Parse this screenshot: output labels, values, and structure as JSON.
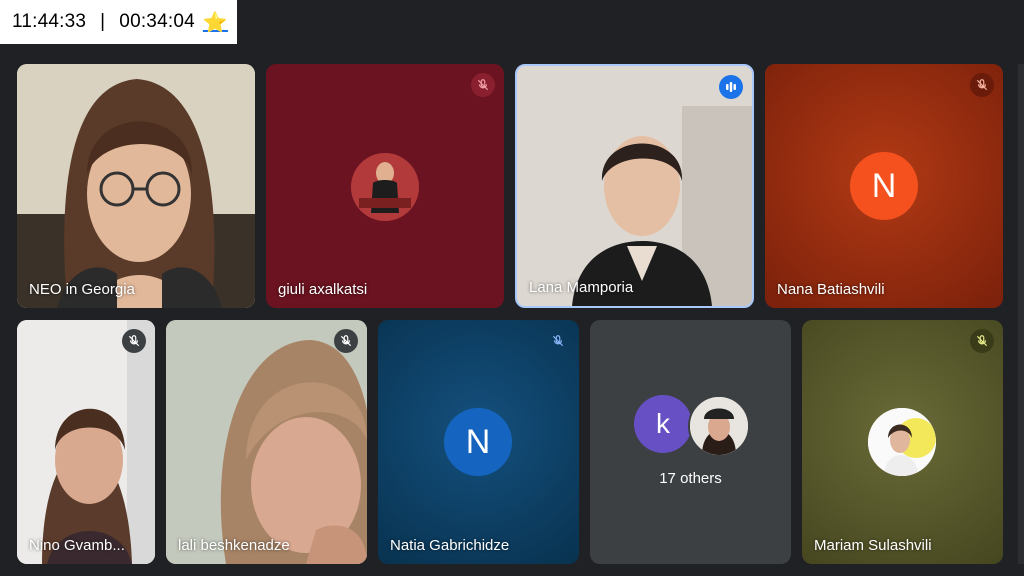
{
  "timer": {
    "clock": "11:44:33",
    "separator": "|",
    "elapsed": "00:34:04",
    "star": "⭐"
  },
  "participants": [
    {
      "name": "NEO in Georgia",
      "video": true,
      "muted": false
    },
    {
      "name": "giuli axalkatsi",
      "video": false,
      "muted": true,
      "avatar": "photo",
      "bg": "#6b1320"
    },
    {
      "name": "Lana Mamporia",
      "video": true,
      "muted": false,
      "speaking": true
    },
    {
      "name": "Nana Batiashvili",
      "video": false,
      "muted": true,
      "avatar": "N",
      "bg": "#8e2a10",
      "avatar_color": "#f4511e"
    },
    {
      "name": "Nino Gvamb...",
      "video": true,
      "muted": true
    },
    {
      "name": "lali beshkenadze",
      "video": true,
      "muted": true
    },
    {
      "name": "Natia Gabrichidze",
      "video": false,
      "muted": true,
      "avatar": "N",
      "bg": "#0b3d63",
      "avatar_color": "#1565c0"
    },
    {
      "name": "Mariam Sulashvili",
      "video": false,
      "muted": true,
      "avatar": "photo",
      "bg": "#5a5b2e"
    }
  ],
  "others": {
    "label": "17 others",
    "avatar_letter": "k",
    "avatar_color": "#6750c4"
  },
  "icons": {
    "mute": "mic-off-icon",
    "speaking": "audio-level-icon"
  }
}
